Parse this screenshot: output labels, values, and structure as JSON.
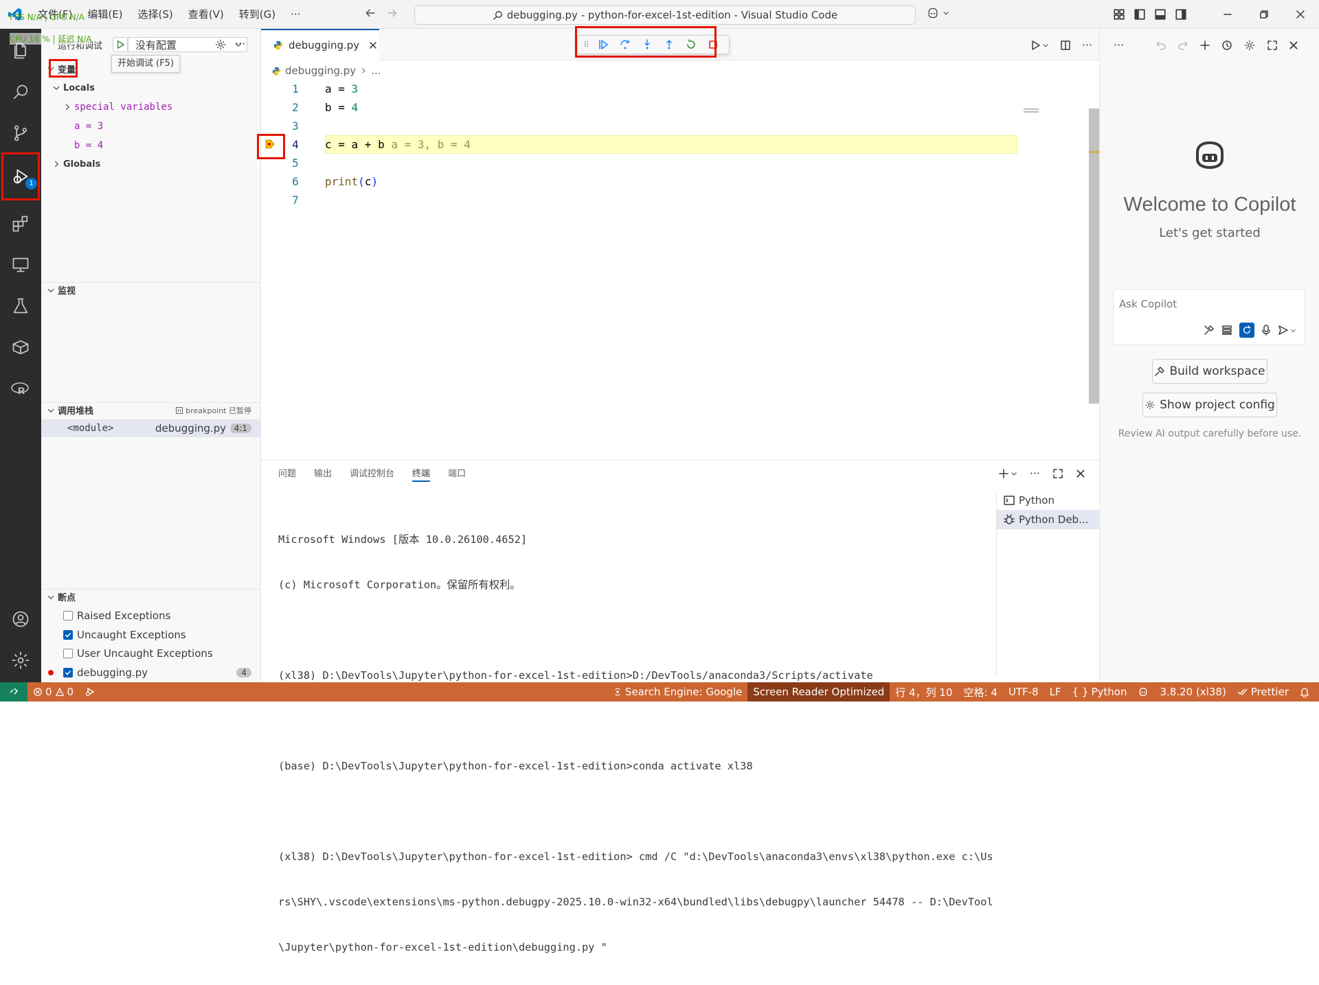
{
  "titlebar": {
    "menu": [
      "文件(F)",
      "编辑(E)",
      "选择(S)",
      "查看(V)",
      "转到(G)",
      "···"
    ],
    "title": "debugging.py - python-for-excel-1st-edition - Visual Studio Code"
  },
  "perf": {
    "line1": "FPS  N/A  |  GPU  N/A",
    "line2": "CPU  16 %  |  延迟  N/A"
  },
  "sidebar": {
    "title": "运行和调试",
    "config": "没有配置",
    "tooltip": "开始调试 (F5)",
    "variables_title": "变量",
    "locals": "Locals",
    "special": "special variables",
    "var_a": "a = 3",
    "var_b": "b = 4",
    "globals": "Globals",
    "watch_title": "监视",
    "callstack_title": "调用堆栈",
    "callstack_status": "breakpoint 已暂停",
    "frame_name": "<module>",
    "frame_file": "debugging.py",
    "frame_pos": "4:1",
    "breakpoints_title": "断点",
    "bp_items": [
      {
        "label": "Raised Exceptions",
        "checked": false
      },
      {
        "label": "Uncaught Exceptions",
        "checked": true
      },
      {
        "label": "User Uncaught Exceptions",
        "checked": false
      },
      {
        "label": "debugging.py",
        "checked": true,
        "count": "4"
      }
    ]
  },
  "editor": {
    "tab": "debugging.py",
    "crumb_file": "debugging.py",
    "crumb_more": "...",
    "line_numbers": [
      "1",
      "2",
      "3",
      "4",
      "5",
      "6",
      "7"
    ],
    "inline_value": "a = 3, b = 4"
  },
  "panel": {
    "tabs": [
      "问题",
      "输出",
      "调试控制台",
      "终端",
      "端口"
    ],
    "active_tab": "终端",
    "terminal_lines": [
      "Microsoft Windows [版本 10.0.26100.4652]",
      "(c) Microsoft Corporation。保留所有权利。",
      "",
      "(xl38) D:\\DevTools\\Jupyter\\python-for-excel-1st-edition>D:/DevTools/anaconda3/Scripts/activate",
      "",
      "(base) D:\\DevTools\\Jupyter\\python-for-excel-1st-edition>conda activate xl38",
      "",
      "(xl38) D:\\DevTools\\Jupyter\\python-for-excel-1st-edition> cmd /C \"d:\\DevTools\\anaconda3\\envs\\xl38\\python.exe c:\\Use",
      "rs\\SHY\\.vscode\\extensions\\ms-python.debugpy-2025.10.0-win32-x64\\bundled\\libs\\debugpy\\launcher 54478 -- D:\\DevTools",
      "\\Jupyter\\python-for-excel-1st-edition\\debugging.py \""
    ],
    "term_list": [
      "Python",
      "Python Deb..."
    ]
  },
  "copilot": {
    "title": "Welcome to Copilot",
    "subtitle": "Let's get started",
    "placeholder": "Ask Copilot",
    "build": "Build workspace",
    "config": "Show project config",
    "note": "Review AI output carefully before use."
  },
  "status": {
    "errors": "0",
    "warnings": "0",
    "search": "Search Engine: Google",
    "sro": "Screen Reader Optimized",
    "pos": "行 4，列 10",
    "spaces": "空格: 4",
    "enc": "UTF-8",
    "eol": "LF",
    "lang": "Python",
    "env": "3.8.20 (xl38)",
    "prettier": "Prettier"
  },
  "colors": {
    "accent": "#005fb8",
    "statusbar": "#cc6633",
    "highlight_box": "#e51400",
    "debug_line": "#ffffc2"
  }
}
